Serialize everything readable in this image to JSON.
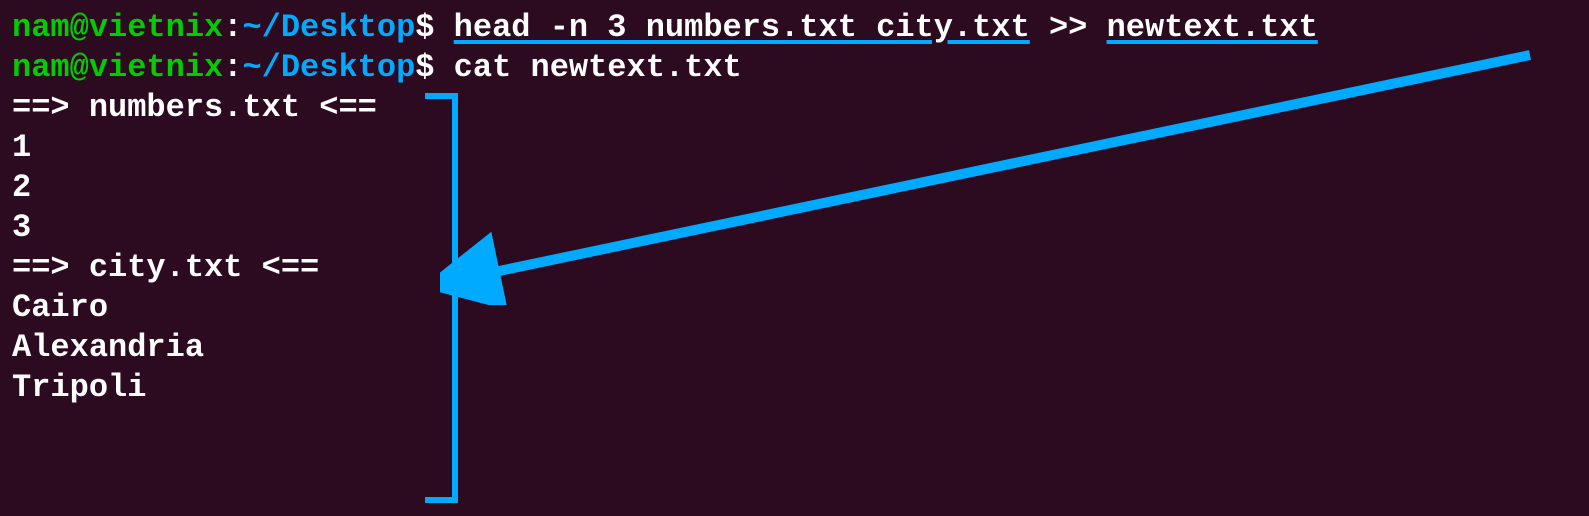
{
  "prompt": {
    "user": "nam",
    "host": "vietnix",
    "path": "~/Desktop",
    "separator": "@",
    "colon": ":",
    "dollar": "$"
  },
  "commands": {
    "line1": {
      "cmd_prefix": "head -n 3 numbers.txt city.txt",
      "redirect": ">>",
      "target": "newtext.txt"
    },
    "line2": {
      "cmd": "cat newtext.txt"
    }
  },
  "output": {
    "header1": "==> numbers.txt <==",
    "n1": "1",
    "n2": "2",
    "n3": "3",
    "blank": "",
    "header2": "==> city.txt <==",
    "city1": "Cairo",
    "city2": "Alexandria",
    "city3": "Tripoli"
  }
}
